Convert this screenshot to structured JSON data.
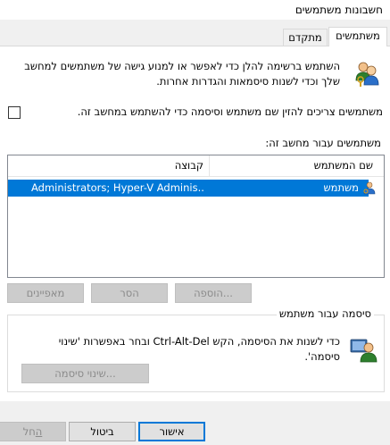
{
  "window": {
    "title": "חשבונות משתמשים"
  },
  "tabs": [
    {
      "label": "משתמשים",
      "active": true
    },
    {
      "label": "מתקדם",
      "active": false
    }
  ],
  "users_tab": {
    "description": "השתמש ברשימה להלן כדי לאפשר או למנוע גישה של משתמשים למחשב שלך וכדי לשנות סיסמאות והגדרות אחרות.",
    "require_password_checkbox": {
      "label": "משתמשים צריכים להזין שם משתמש וסיסמה כדי להשתמש במחשב זה.",
      "checked": false
    },
    "list_label": "משתמשים עבור מחשב זה:",
    "columns": {
      "username": "שם המשתמש",
      "group": "קבוצה"
    },
    "rows": [
      {
        "username": "משתמש",
        "group": "Administrators; Hyper-V Adminis...",
        "selected": true
      }
    ],
    "buttons": {
      "add": "הוספה...",
      "remove": "הסר",
      "properties": "מאפיינים"
    },
    "password_group": {
      "title": "סיסמה עבור משתמש",
      "text": "כדי לשנות את הסיסמה, הקש Ctrl-Alt-Del ובחר באפשרות 'שינוי סיסמה'.",
      "button": "שינוי סיסמה..."
    }
  },
  "footer": {
    "ok": "אישור",
    "cancel": "ביטול",
    "apply_prefix": "",
    "apply_accel": "ה",
    "apply_rest": "חל"
  },
  "colors": {
    "selection": "#0078d7",
    "window_bg": "#f0f0f0",
    "panel_bg": "#ffffff",
    "disabled_text": "#8a8a8a"
  },
  "icons": {
    "users": "users-icon",
    "user_row": "user-icon",
    "password": "password-user-icon"
  }
}
